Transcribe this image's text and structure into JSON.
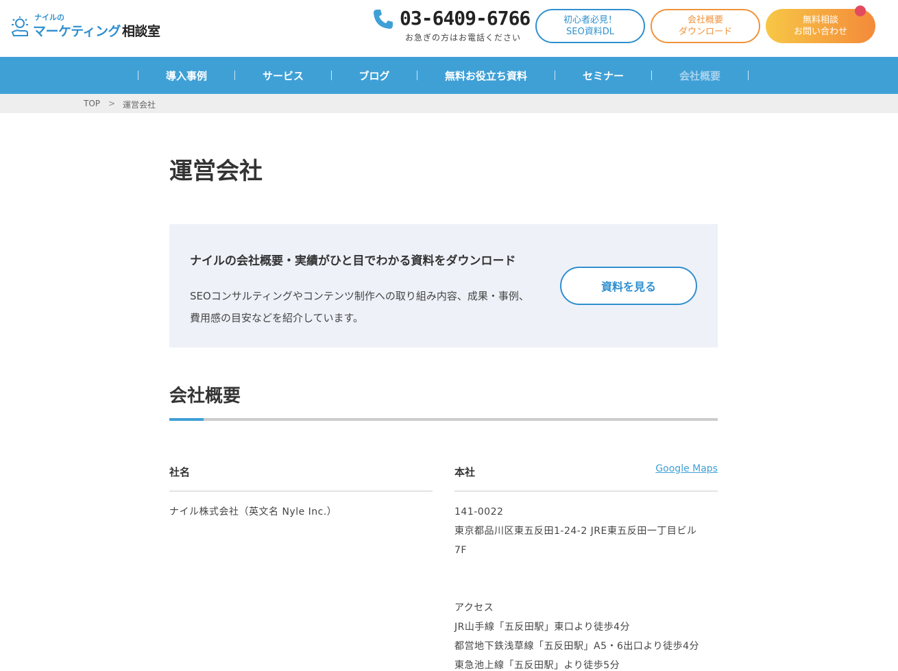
{
  "header": {
    "logo": {
      "small": "ナイルの",
      "main": "マーケティング",
      "main_dark": "相談室"
    },
    "phone": {
      "number": "03-6409-6766",
      "note": "お急ぎの方はお電話ください"
    },
    "buttons": {
      "seo_line1": "初心者必見！",
      "seo_line2": "SEO資料DL",
      "dl_line1": "会社概要",
      "dl_line2": "ダウンロード",
      "contact_line1": "無料相談",
      "contact_line2": "お問い合わせ"
    }
  },
  "nav": {
    "items": [
      {
        "label": "導入事例"
      },
      {
        "label": "サービス"
      },
      {
        "label": "ブログ"
      },
      {
        "label": "無料お役立ち資料"
      },
      {
        "label": "セミナー"
      },
      {
        "label": "会社概要"
      }
    ]
  },
  "breadcrumb": {
    "top": "TOP",
    "arrow": ">",
    "current": "運営会社"
  },
  "page": {
    "title": "運営会社"
  },
  "cta": {
    "title": "ナイルの会社概要・実績がひと目でわかる資料をダウンロード",
    "text_line1": "SEOコンサルティングやコンテンツ制作への取り組み内容、成果・事例、",
    "text_line2": "費用感の目安などを紹介しています。",
    "button": "資料を見る"
  },
  "company": {
    "section_title": "会社概要",
    "name_label": "社名",
    "name_value": "ナイル株式会社（英文名 Nyle Inc.）",
    "hq_label": "本社",
    "maps_link": "Google Maps",
    "postal": "141-0022",
    "address1": "東京都品川区東五反田1-24-2 JRE東五反田一丁目ビル",
    "address2": "7F",
    "access_label": "アクセス",
    "access1": "JR山手線「五反田駅」東口より徒歩4分",
    "access2": "都営地下鉄浅草線「五反田駅」A5・6出口より徒歩4分",
    "access3": "東急池上線「五反田駅」より徒歩5分"
  },
  "colors": {
    "primary": "#3fa0d6",
    "accent_orange": "#f0923a",
    "notification": "#e24b5f",
    "cta_bg": "#eef1f8"
  }
}
